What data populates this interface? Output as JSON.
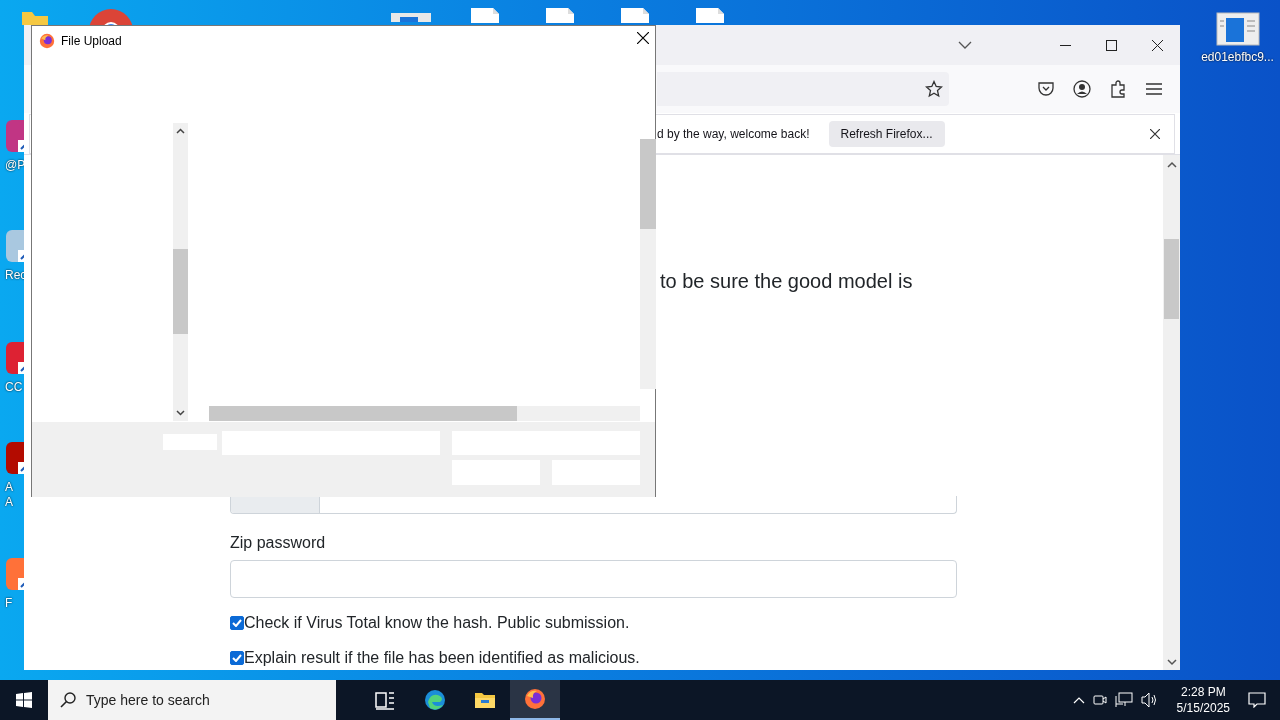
{
  "desktop": {
    "left_icons": [
      {
        "kind": "social",
        "label": "@P"
      },
      {
        "kind": "bin",
        "label": "Rec"
      },
      {
        "kind": "app",
        "label": "CC"
      },
      {
        "kind": "pdf",
        "label": "A\nA"
      },
      {
        "kind": "firefox",
        "label": "F"
      }
    ],
    "top_icons": [
      {
        "kind": "folder"
      },
      {
        "kind": "chrome"
      },
      {
        "kind": "window"
      },
      {
        "kind": "file"
      },
      {
        "kind": "file"
      },
      {
        "kind": "file"
      },
      {
        "kind": "file"
      }
    ],
    "right_icon": {
      "label": "ed01ebfbc9..."
    }
  },
  "browser": {
    "notification": {
      "message": "d by the way, welcome back!",
      "button": "Refresh Firefox..."
    },
    "content": {
      "heading": "to be sure the good model is",
      "zip_label": "Zip password",
      "options": [
        {
          "label": "Check if Virus Total know the hash. Public submission.",
          "checked": true
        },
        {
          "label": "Explain result if the file has been identified as malicious.",
          "checked": true
        }
      ]
    }
  },
  "dialog": {
    "title": "File Upload"
  },
  "taskbar": {
    "search_placeholder": "Type here to search",
    "apps": [
      {
        "kind": "task-view",
        "selected": false
      },
      {
        "kind": "edge",
        "selected": false
      },
      {
        "kind": "explorer",
        "selected": false
      },
      {
        "kind": "firefox",
        "selected": true
      }
    ],
    "time": "2:28 PM",
    "date": "5/15/2025"
  }
}
